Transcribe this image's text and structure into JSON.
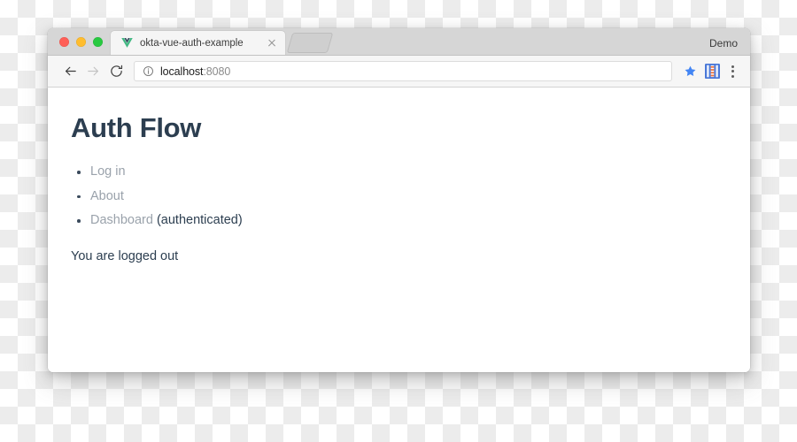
{
  "browser": {
    "window_controls": [
      {
        "name": "close",
        "color": "#ff5f57"
      },
      {
        "name": "minimize",
        "color": "#ffbd2e"
      },
      {
        "name": "zoom",
        "color": "#28c940"
      }
    ],
    "tab": {
      "title": "okta-vue-auth-example",
      "favicon_icon": "vue-logo-icon",
      "close_icon": "close-icon"
    },
    "new_tab_label": "",
    "profile_label": "Demo",
    "toolbar": {
      "back_icon": "back-arrow-icon",
      "forward_icon": "forward-arrow-icon",
      "reload_icon": "reload-icon",
      "info_icon": "info-circle-icon",
      "url_host": "localhost",
      "url_port": ":8080",
      "url_full": "localhost:8080",
      "star_icon": "bookmark-star-icon",
      "extension_icon": "extension-icon",
      "menu_icon": "three-dot-menu-icon"
    }
  },
  "page": {
    "title": "Auth Flow",
    "links": [
      {
        "label": "Log in",
        "note": ""
      },
      {
        "label": "About",
        "note": ""
      },
      {
        "label": "Dashboard",
        "note": "(authenticated)"
      }
    ],
    "status": "You are logged out"
  },
  "colors": {
    "heading": "#2c3e50",
    "link": "#9aa2ab",
    "star": "#4285f4",
    "vue_green": "#42b883",
    "vue_dark": "#35495e"
  }
}
